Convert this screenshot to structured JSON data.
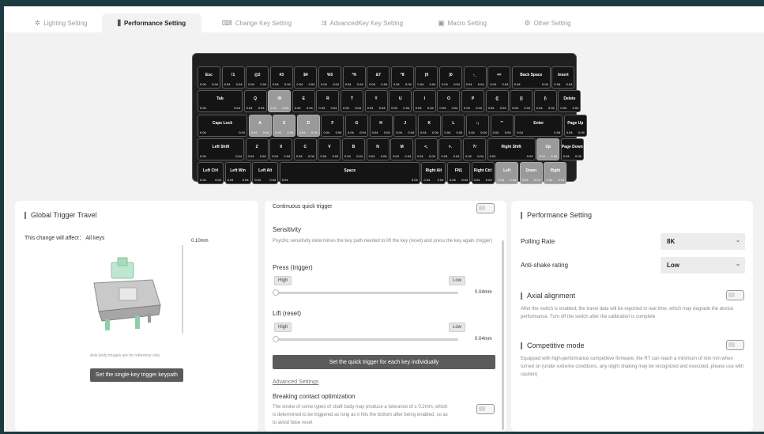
{
  "tabs": [
    {
      "label": "Lighting Setting",
      "icon": "✲"
    },
    {
      "label": "Performance Setting",
      "icon": "⫼"
    },
    {
      "label": "Change Key Setting",
      "icon": "⌨"
    },
    {
      "label": "AdvancedKey Key Setting",
      "icon": "⇉"
    },
    {
      "label": "Macro Setting",
      "icon": "▣"
    },
    {
      "label": "Other Setting",
      "icon": "⚙"
    }
  ],
  "key_default_values": [
    "0.04",
    "0.04"
  ],
  "keys": [
    [
      {
        "l": "Esc"
      },
      {
        "l": "!1"
      },
      {
        "l": "@2"
      },
      {
        "l": "#3"
      },
      {
        "l": "$4"
      },
      {
        "l": "%5"
      },
      {
        "l": "^6"
      },
      {
        "l": "&7"
      },
      {
        "l": "*8"
      },
      {
        "l": "(9"
      },
      {
        "l": ")0"
      },
      {
        "l": "-_"
      },
      {
        "l": "+="
      },
      {
        "l": "Back Space"
      },
      {
        "l": "Insert"
      }
    ],
    [
      {
        "l": "Tab"
      },
      {
        "l": "Q"
      },
      {
        "l": "W",
        "sel": true,
        "v1": "0.34"
      },
      {
        "l": "E"
      },
      {
        "l": "R"
      },
      {
        "l": "T"
      },
      {
        "l": "Y"
      },
      {
        "l": "U"
      },
      {
        "l": "I"
      },
      {
        "l": "O"
      },
      {
        "l": "P"
      },
      {
        "l": "{["
      },
      {
        "l": "}]"
      },
      {
        "l": "|\\"
      },
      {
        "l": "Delete"
      }
    ],
    [
      {
        "l": "Caps Lock"
      },
      {
        "l": "A",
        "sel": true
      },
      {
        "l": "S",
        "sel": true
      },
      {
        "l": "D",
        "sel": true
      },
      {
        "l": "F"
      },
      {
        "l": "G"
      },
      {
        "l": "H"
      },
      {
        "l": "J"
      },
      {
        "l": "K"
      },
      {
        "l": "L"
      },
      {
        "l": ":;"
      },
      {
        "l": "\"'"
      },
      {
        "l": "Enter"
      },
      {
        "l": "Page Up"
      }
    ],
    [
      {
        "l": "Left Shift"
      },
      {
        "l": "Z"
      },
      {
        "l": "X"
      },
      {
        "l": "C"
      },
      {
        "l": "V"
      },
      {
        "l": "B"
      },
      {
        "l": "N"
      },
      {
        "l": "M"
      },
      {
        "l": "<,"
      },
      {
        "l": ">."
      },
      {
        "l": "?/"
      },
      {
        "l": "Right Shift"
      },
      {
        "l": "Up",
        "sel": true
      },
      {
        "l": "Page Down"
      }
    ],
    [
      {
        "l": "Left Ctrl"
      },
      {
        "l": "Left Win"
      },
      {
        "l": "Left Alt"
      },
      {
        "l": "Space"
      },
      {
        "l": "Right Alt"
      },
      {
        "l": "FN1"
      },
      {
        "l": "Right Ctrl"
      },
      {
        "l": "Left",
        "sel": true
      },
      {
        "l": "Down",
        "sel": true
      },
      {
        "l": "Right",
        "sel": true
      }
    ]
  ],
  "global": {
    "title": "Global Trigger Travel",
    "affect_label": "This change will affect：",
    "affect_value": "All keys",
    "travel_value": "0.10mm",
    "image_note": "Axis body images are for reference only",
    "single_key_button": "Set the single-key trigger keypath"
  },
  "quick": {
    "continuous_label": "Continuous quick trigger",
    "sensitivity_title": "Sensitivity",
    "sensitivity_desc": "Psychic sensitivity determines the key path needed to lift the key (reset) and press the key again (trigger)",
    "press_label": "Press (trigger)",
    "press_high": "High",
    "press_low": "Low",
    "press_value": "0.04mm",
    "lift_label": "Lift (reset)",
    "lift_high": "High",
    "lift_low": "Low",
    "lift_value": "0.04mm",
    "individual_button": "Set the quick trigger for each key individually",
    "advanced_link": "Advanced Settings",
    "breaking_title": "Breaking contact optimization",
    "breaking_desc": "The stroke of some types of shaft body may produce a tolerance of ± 0.2mm, which is determined to be triggered as long as it hits the bottom after being enabled, so as to avoid false reset"
  },
  "performance": {
    "title": "Performance Setting",
    "polling_label": "Polling Rate",
    "polling_value": "8K",
    "antishake_label": "Anti-shake rating",
    "antishake_value": "Low",
    "axial_title": "Axial alignment",
    "axial_desc": "After the switch is enabled, the travel data will be reported in real time, which may degrade the device performance. Turn off the switch after the calibration is complete",
    "competitive_title": "Competitive mode",
    "competitive_desc": "Equipped with high-performance competitive firmware, the RT can reach a minimum of min mm when turned on (under extreme conditions, any slight shaking may be recognized and executed, please use with caution)"
  }
}
